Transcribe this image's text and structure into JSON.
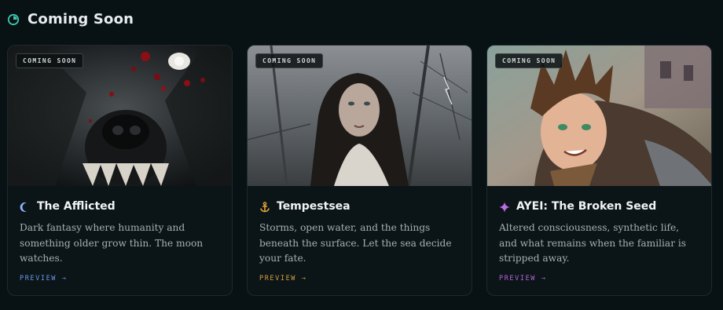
{
  "section": {
    "title": "Coming Soon",
    "icon": "clock-icon",
    "icon_color": "#3fc6b0"
  },
  "cards": [
    {
      "badge": "COMING SOON",
      "title": "The Afflicted",
      "icon": "crescent-moon-icon",
      "icon_color": "#8fb6ff",
      "description": "Dark fantasy where humanity and something older grow thin. The moon watches.",
      "link": "PREVIEW →",
      "link_color": "#6f95e6",
      "art": "werewolf-portrait"
    },
    {
      "badge": "COMING SOON",
      "title": "Tempestsea",
      "icon": "anchor-icon",
      "icon_color": "#e0a53a",
      "description": "Storms, open water, and the things beneath the surface. Let the sea decide your fate.",
      "link": "PREVIEW →",
      "link_color": "#d4a03c",
      "art": "storm-ship-portrait"
    },
    {
      "badge": "COMING SOON",
      "title": "AYEI: The Broken Seed",
      "icon": "sparkle-icon",
      "icon_color": "#c06be6",
      "description": "Altered consciousness, synthetic life, and what remains when the familiar is stripped away.",
      "link": "PREVIEW →",
      "link_color": "#b463d6",
      "art": "anime-hero-portrait"
    }
  ]
}
